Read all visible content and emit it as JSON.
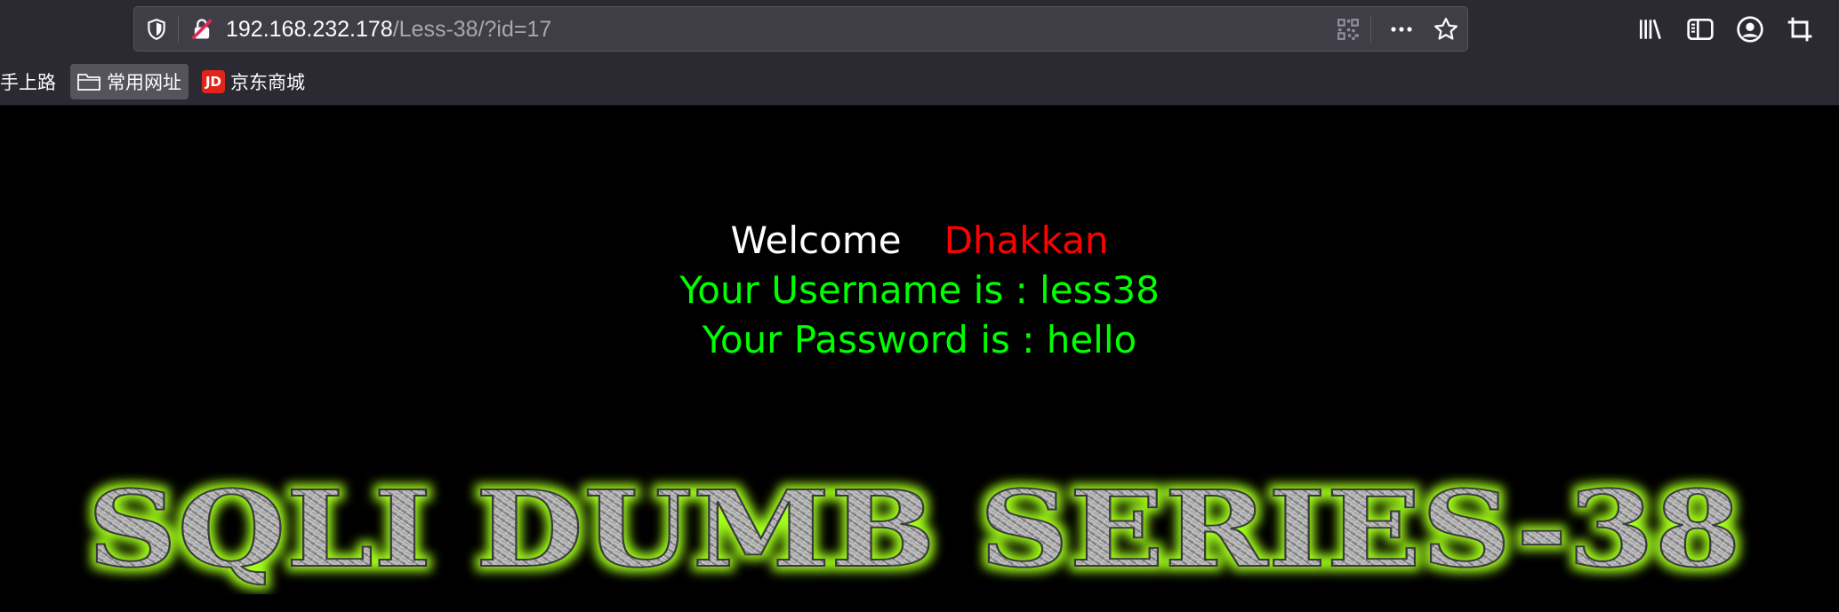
{
  "browser": {
    "url_host": "192.168.232.178",
    "url_path": "/Less-38/?id=17",
    "icons": [
      "shield-icon",
      "insecure-lock-icon",
      "qr-code-icon",
      "more-actions-icon",
      "bookmark-star-icon",
      "library-icon",
      "sidebar-icon",
      "account-icon",
      "crop-icon"
    ]
  },
  "bookmarks": {
    "items": [
      {
        "label": "手上路"
      },
      {
        "label": "常用网址",
        "icon": "folder-icon"
      },
      {
        "label": "京东商城",
        "icon": "jd-logo",
        "logo_text": "JD"
      }
    ]
  },
  "page": {
    "welcome_label": "Welcome",
    "user_display_name": "Dhakkan",
    "username_line": "Your Username is : less38",
    "password_line": "Your Password is : hello",
    "banner_title": "SQLI DUMB SERIES-38",
    "colors": {
      "background": "#000000",
      "welcome": "#ffffff",
      "name": "#ff0000",
      "result": "#00ff00",
      "banner_glow": "#a4ff1a"
    }
  }
}
